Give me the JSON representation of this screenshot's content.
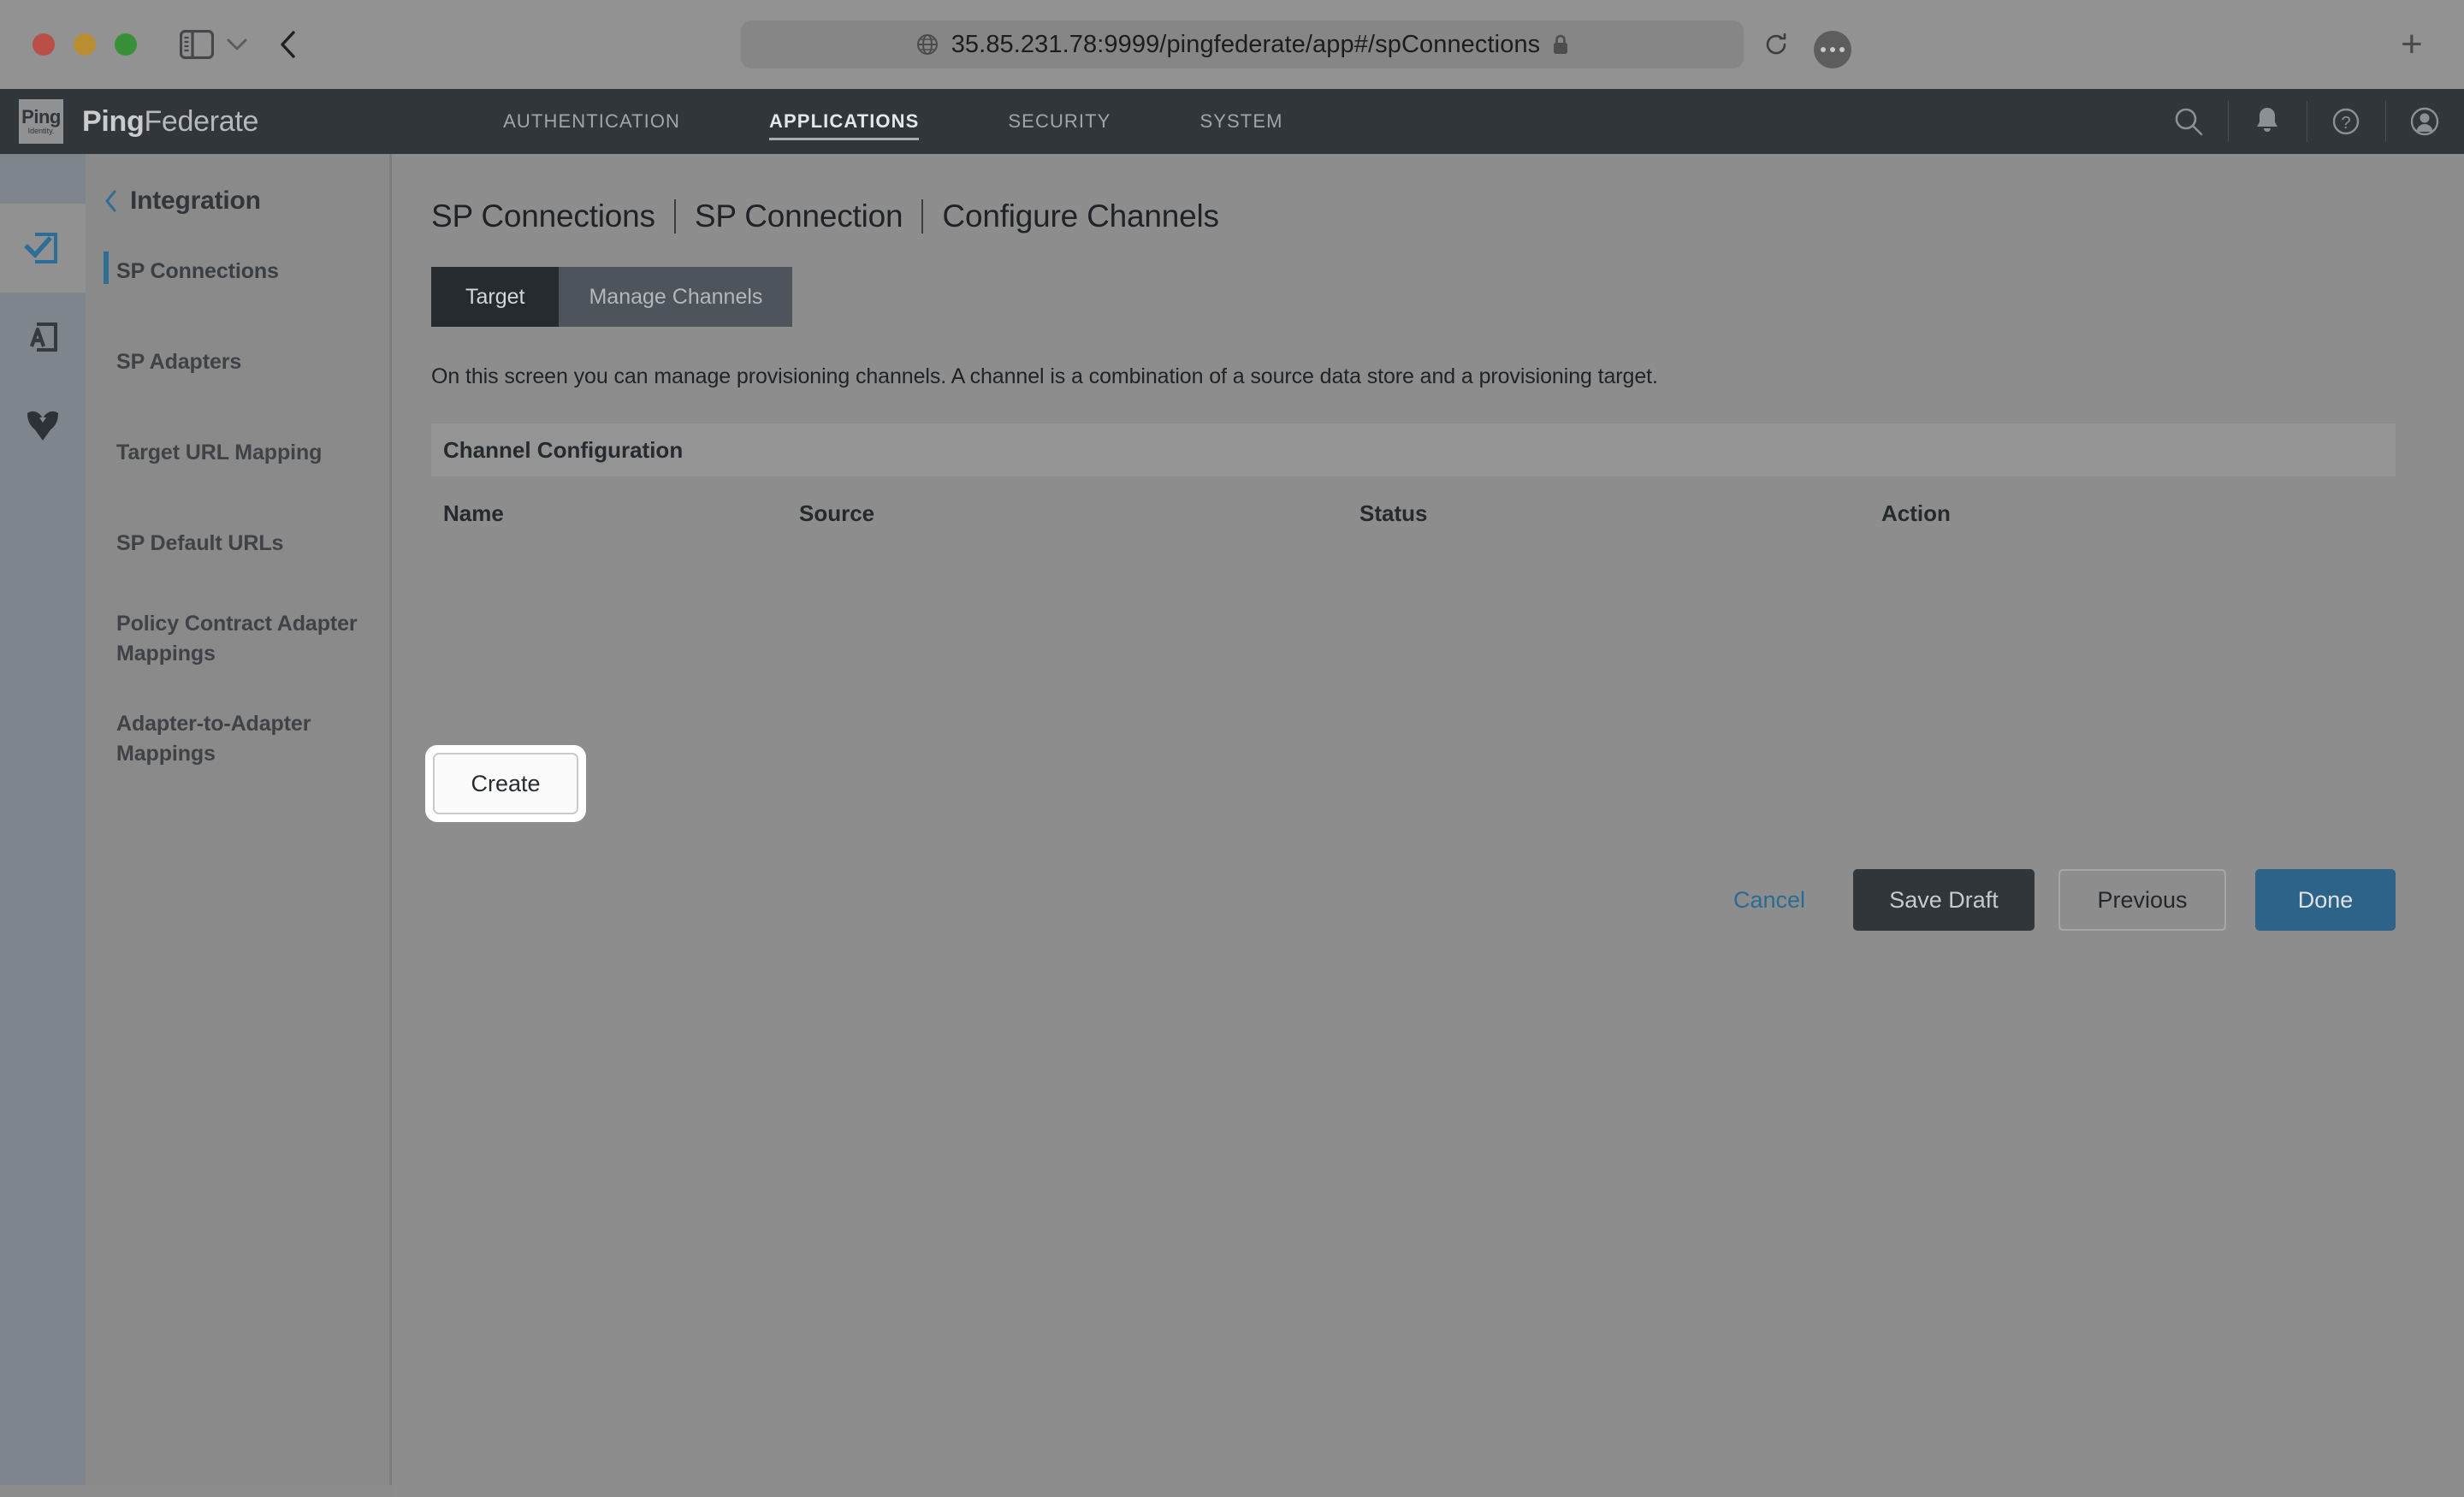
{
  "browser": {
    "url": "35.85.231.78:9999/pingfederate/app#/spConnections",
    "lock_icon": "lock-icon",
    "globe_icon": "globe-icon",
    "reload_icon": "reload-icon",
    "more_icon": "more-dots-icon",
    "new_tab_label": "+",
    "back_icon": "back-chevron-icon",
    "sidebar_icon": "sidebar-toggle-icon",
    "tab_overview_icon": "chevron-down-icon"
  },
  "topnav": {
    "logo_line1": "Ping",
    "logo_line2": "Identity.",
    "brand_bold": "Ping",
    "brand_light": "Federate",
    "items": [
      {
        "label": "AUTHENTICATION",
        "active": false
      },
      {
        "label": "APPLICATIONS",
        "active": true
      },
      {
        "label": "SECURITY",
        "active": false
      },
      {
        "label": "SYSTEM",
        "active": false
      }
    ],
    "icons": [
      {
        "name": "search-icon"
      },
      {
        "name": "notifications-bell-icon"
      },
      {
        "name": "help-question-icon"
      },
      {
        "name": "user-avatar-icon"
      }
    ]
  },
  "rail": {
    "items": [
      {
        "name": "integration-checkbox-icon",
        "active": true
      },
      {
        "name": "adapter-a-icon",
        "active": false
      },
      {
        "name": "shield-badge-icon",
        "active": false
      }
    ]
  },
  "sidebar": {
    "back_icon": "back-chevron-icon",
    "title": "Integration",
    "items": [
      {
        "label": "SP Connections",
        "active": true
      },
      {
        "label": "SP Adapters",
        "active": false
      },
      {
        "label": "Target URL Mapping",
        "active": false
      },
      {
        "label": "SP Default URLs",
        "active": false
      },
      {
        "label": "Policy Contract Adapter Mappings",
        "active": false
      },
      {
        "label": "Adapter-to-Adapter Mappings",
        "active": false
      }
    ]
  },
  "main": {
    "breadcrumb": [
      "SP Connections",
      "SP Connection",
      "Configure Channels"
    ],
    "tabs": [
      {
        "label": "Target",
        "active": true
      },
      {
        "label": "Manage Channels",
        "active": false
      }
    ],
    "description": "On this screen you can manage provisioning channels. A channel is a combination of a source data store and a provisioning target.",
    "panel_title": "Channel Configuration",
    "table": {
      "columns": [
        "Name",
        "Source",
        "Status",
        "Action"
      ],
      "rows": []
    },
    "create_button": "Create",
    "footer": {
      "cancel": "Cancel",
      "save_draft": "Save Draft",
      "previous": "Previous",
      "done": "Done"
    }
  },
  "colors": {
    "accent_blue": "#2e6e96",
    "done_blue": "#2e6389",
    "nav_dark": "#31363b",
    "tab_active": "#262b30",
    "tab_inactive": "#4d545b",
    "page_bg": "#8d8d8d",
    "sidebar_bg": "#8a8a8a",
    "rail_bg": "#7e858c"
  }
}
